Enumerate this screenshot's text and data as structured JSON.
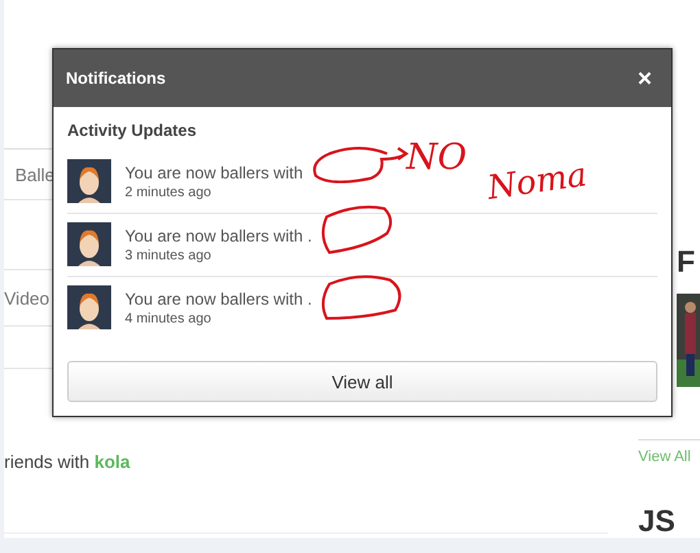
{
  "page": {
    "tab_label": "Balle",
    "video_label": "Video",
    "activity_text": "riends with **kola**",
    "right_heading": "F",
    "right_link": "View All",
    "right_heading_2": "JS"
  },
  "modal": {
    "title": "Notifications",
    "close": "×",
    "section": "Activity Updates",
    "items": [
      {
        "text": "You are now ballers with",
        "time": "2 minutes ago"
      },
      {
        "text": "You are now ballers with .",
        "time": "3 minutes ago"
      },
      {
        "text": "You are now ballers with .",
        "time": "4 minutes ago"
      }
    ],
    "button": "View all"
  },
  "annotations": [
    {
      "text": "NO"
    },
    {
      "text": "Noma"
    }
  ]
}
